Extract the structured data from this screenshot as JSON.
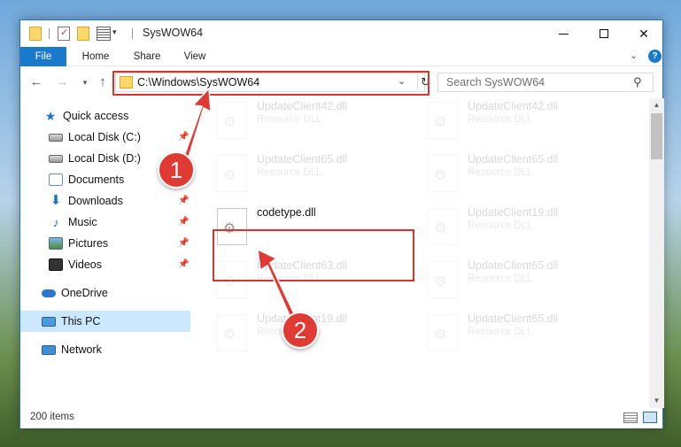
{
  "window": {
    "title": "SysWOW64"
  },
  "ribbon": {
    "tabs": [
      "File",
      "Home",
      "Share",
      "View"
    ],
    "help": "?"
  },
  "nav": {
    "address": "C:\\Windows\\SysWOW64",
    "search_placeholder": "Search SysWOW64"
  },
  "sidebar": {
    "items": [
      {
        "label": "Quick access",
        "icon": "star-icon",
        "pinned": false
      },
      {
        "label": "Local Disk (C:)",
        "icon": "disk-icon",
        "pinned": true
      },
      {
        "label": "Local Disk (D:)",
        "icon": "disk-icon",
        "pinned": true
      },
      {
        "label": "Documents",
        "icon": "documents-icon",
        "pinned": true
      },
      {
        "label": "Downloads",
        "icon": "download-icon",
        "pinned": true
      },
      {
        "label": "Music",
        "icon": "music-icon",
        "pinned": true
      },
      {
        "label": "Pictures",
        "icon": "pictures-icon",
        "pinned": true
      },
      {
        "label": "Videos",
        "icon": "videos-icon",
        "pinned": true
      },
      {
        "label": "OneDrive",
        "icon": "onedrive-icon",
        "pinned": false
      },
      {
        "label": "This PC",
        "icon": "pc-icon",
        "pinned": false,
        "selected": true
      },
      {
        "label": "Network",
        "icon": "network-icon",
        "pinned": false
      }
    ]
  },
  "files": [
    {
      "name": "UpdateClient42.dll",
      "type": "Resource DLL",
      "faded": true
    },
    {
      "name": "UpdateClient42.dll",
      "type": "Resource DLL",
      "faded": true
    },
    {
      "name": "UpdateClient65.dll",
      "type": "Resource DLL",
      "faded": true
    },
    {
      "name": "UpdateClient65.dll",
      "type": "Resource DLL",
      "faded": true
    },
    {
      "name": "codetype.dll",
      "type": "",
      "faded": false
    },
    {
      "name": "UpdateClient19.dll",
      "type": "Resource DLL",
      "faded": true
    },
    {
      "name": "UpdateClient63.dll",
      "type": "Resource DLL",
      "faded": true
    },
    {
      "name": "UpdateClient65.dll",
      "type": "Resource DLL",
      "faded": true
    },
    {
      "name": "UpdateClient19.dll",
      "type": "Resource DLL",
      "faded": true
    },
    {
      "name": "UpdateClient65.dll",
      "type": "Resource DLL",
      "faded": true
    }
  ],
  "status": {
    "count": "200 items"
  },
  "annotations": {
    "step1": "1",
    "step2": "2",
    "highlight_color": "#d8342f"
  }
}
